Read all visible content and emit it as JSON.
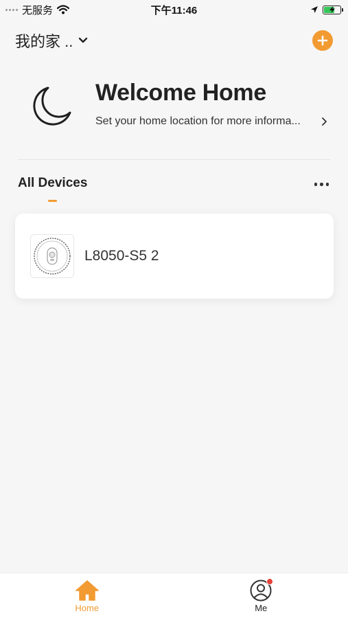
{
  "status_bar": {
    "carrier": "无服务",
    "time": "下午11:46",
    "battery_level_fraction": 0.6
  },
  "header": {
    "home_name": "我的家 ..",
    "add_icon": "plus-icon",
    "switch_icon": "chevron-down-icon"
  },
  "welcome": {
    "title": "Welcome Home",
    "subtitle": "Set your home location for more informa..."
  },
  "tabs": {
    "all_devices": "All Devices",
    "more_icon": "more-dots-icon"
  },
  "devices": [
    {
      "name": "L8050-S5 2"
    }
  ],
  "tabbar": {
    "home_label": "Home",
    "me_label": "Me",
    "me_has_notification": true
  },
  "colors": {
    "accent": "#f29b32",
    "background": "#f6f6f6",
    "notification": "#e8423a",
    "battery": "#34c759"
  }
}
